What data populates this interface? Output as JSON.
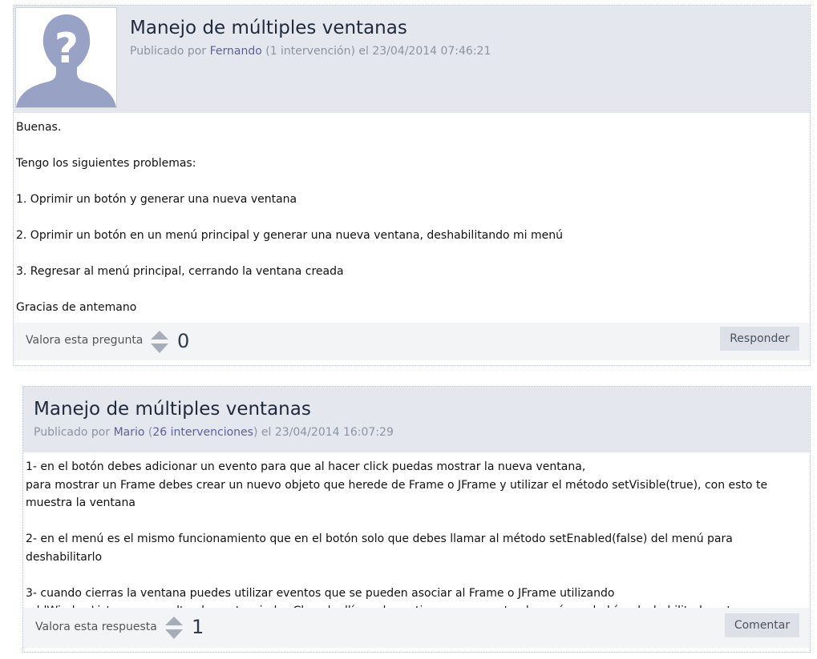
{
  "question": {
    "title": "Manejo de múltiples ventanas",
    "meta": {
      "prefix": "Publicado por",
      "author": "Fernando",
      "count_open": "(",
      "count_link": "1 intervención",
      "count_close": ")",
      "date": "el 23/04/2014 07:46:21"
    },
    "body": [
      "Buenas.",
      "",
      "Tengo los siguientes problemas:",
      "",
      "1. Oprimir un botón y generar una nueva ventana",
      "",
      "2. Oprimir un botón en un menú principal y generar una nueva ventana, deshabilitando mi menú",
      "",
      "3. Regresar al menú principal, cerrando la ventana creada",
      "",
      "Gracias de antemano"
    ],
    "rate_label": "Valora esta pregunta",
    "score": "0",
    "action_label": "Responder"
  },
  "answer": {
    "title": "Manejo de múltiples ventanas",
    "meta": {
      "prefix": "Publicado por",
      "author": "Mario",
      "count_open": "(",
      "count_link": "26 intervenciones",
      "count_close": ")",
      "date": "el 23/04/2014 16:07:29"
    },
    "body": [
      "1- en el botón debes adicionar un evento para que al hacer click puedas mostrar la nueva ventana,",
      "para mostrar un Frame debes crear un nuevo objeto que herede de Frame o JFrame y utilizar el método setVisible(true), con esto te muestra la ventana",
      "",
      "2- en el menú es el mismo funcionamiento que en el botón solo que debes llamar al método setEnabled(false) del menú para deshabilitarlo",
      "",
      "3- cuando cierras la ventana puedes utilizar eventos que se pueden asociar al Frame o JFrame utilizando",
      "addWindowListener, consulta el evento windowClosed, allí puedes activar nuevamente el menú que habías deshabilitado antes"
    ],
    "rate_label": "Valora esta respuesta",
    "score": "1",
    "action_label": "Comentar"
  },
  "icons": {
    "avatar": "unknown-user-avatar",
    "vote": "vote-up-down-icon"
  },
  "colors": {
    "header_bg": "#e4e8ee",
    "footer_bg": "#f3f4f6",
    "link": "#5b6197",
    "avatar_fill": "#98a2c4"
  }
}
